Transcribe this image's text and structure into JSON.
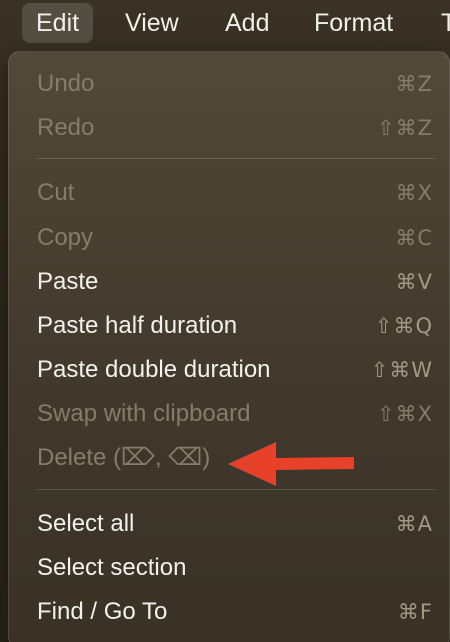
{
  "menubar": {
    "items": [
      {
        "label": "Edit"
      },
      {
        "label": "View"
      },
      {
        "label": "Add"
      },
      {
        "label": "Format"
      },
      {
        "label": "T"
      }
    ]
  },
  "menu": {
    "items": [
      {
        "label": "Undo",
        "shortcut": "⌘Z",
        "enabled": false
      },
      {
        "label": "Redo",
        "shortcut": "⇧⌘Z",
        "enabled": false
      },
      {
        "label": "Cut",
        "shortcut": "⌘X",
        "enabled": false
      },
      {
        "label": "Copy",
        "shortcut": "⌘C",
        "enabled": false
      },
      {
        "label": "Paste",
        "shortcut": "⌘V",
        "enabled": true
      },
      {
        "label": "Paste half duration",
        "shortcut": "⇧⌘Q",
        "enabled": true
      },
      {
        "label": "Paste double duration",
        "shortcut": "⇧⌘W",
        "enabled": true
      },
      {
        "label": "Swap with clipboard",
        "shortcut": "⇧⌘X",
        "enabled": false
      },
      {
        "label": "Delete (⌦, ⌫)",
        "shortcut": "",
        "enabled": false
      },
      {
        "label": "Select all",
        "shortcut": "⌘A",
        "enabled": true
      },
      {
        "label": "Select section",
        "shortcut": "",
        "enabled": true
      },
      {
        "label": "Find / Go To",
        "shortcut": "⌘F",
        "enabled": true
      }
    ]
  },
  "annotation": {
    "arrow_color": "#e8412a",
    "points_to": "Delete (⌦, ⌫)"
  },
  "colors": {
    "text_enabled": "#f4f1ec",
    "text_disabled": "#877c6c"
  }
}
